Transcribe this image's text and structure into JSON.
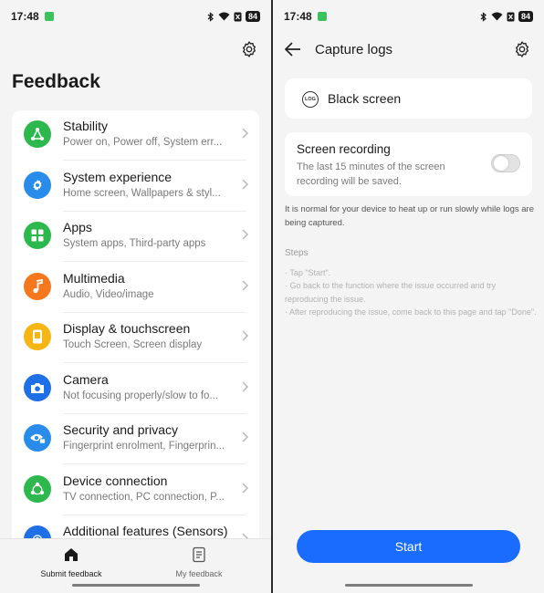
{
  "left": {
    "status": {
      "time": "17:48",
      "battery": "84"
    },
    "title": "Feedback",
    "items": [
      {
        "title": "Stability",
        "subtitle": "Power on, Power off, System err...",
        "color": "#2db84d",
        "icon": "stability-icon"
      },
      {
        "title": "System experience",
        "subtitle": "Home screen, Wallpapers & styl...",
        "color": "#2a8cea",
        "icon": "system-gear-icon"
      },
      {
        "title": "Apps",
        "subtitle": "System apps, Third-party apps",
        "color": "#2db84d",
        "icon": "apps-grid-icon"
      },
      {
        "title": "Multimedia",
        "subtitle": "Audio, Video/image",
        "color": "#f5781e",
        "icon": "music-note-icon"
      },
      {
        "title": "Display & touchscreen",
        "subtitle": "Touch Screen, Screen display",
        "color": "#f5b612",
        "icon": "phone-display-icon"
      },
      {
        "title": "Camera",
        "subtitle": "Not focusing properly/slow to fo...",
        "color": "#1f6fe6",
        "icon": "camera-icon"
      },
      {
        "title": "Security and privacy",
        "subtitle": "Fingerprint enrolment, Fingerprin...",
        "color": "#2a8cea",
        "icon": "eye-lock-icon"
      },
      {
        "title": "Device connection",
        "subtitle": "TV connection, PC connection, P...",
        "color": "#2db84d",
        "icon": "share-nodes-icon"
      },
      {
        "title": "Additional features (Sensors)",
        "subtitle": "",
        "color": "#1f6fe6",
        "icon": "fingerprint-icon"
      }
    ],
    "nav": {
      "submit": "Submit feedback",
      "my": "My feedback"
    }
  },
  "right": {
    "status": {
      "time": "17:48",
      "battery": "84"
    },
    "title": "Capture logs",
    "log_badge": "LOG",
    "black_screen": "Black screen",
    "recording": {
      "title": "Screen recording",
      "desc": "The last 15 minutes of the screen recording will be saved.",
      "enabled": false
    },
    "note": "It is normal for your device to heat up or run slowly while logs are being captured.",
    "steps_title": "Steps",
    "steps": [
      "Tap \"Start\".",
      "Go back to the function where the issue occurred and try reproducing the issue.",
      "After reproducing the issue, come back to this page and tap \"Done\"."
    ],
    "start": "Start",
    "accent": "#1a6cff"
  }
}
